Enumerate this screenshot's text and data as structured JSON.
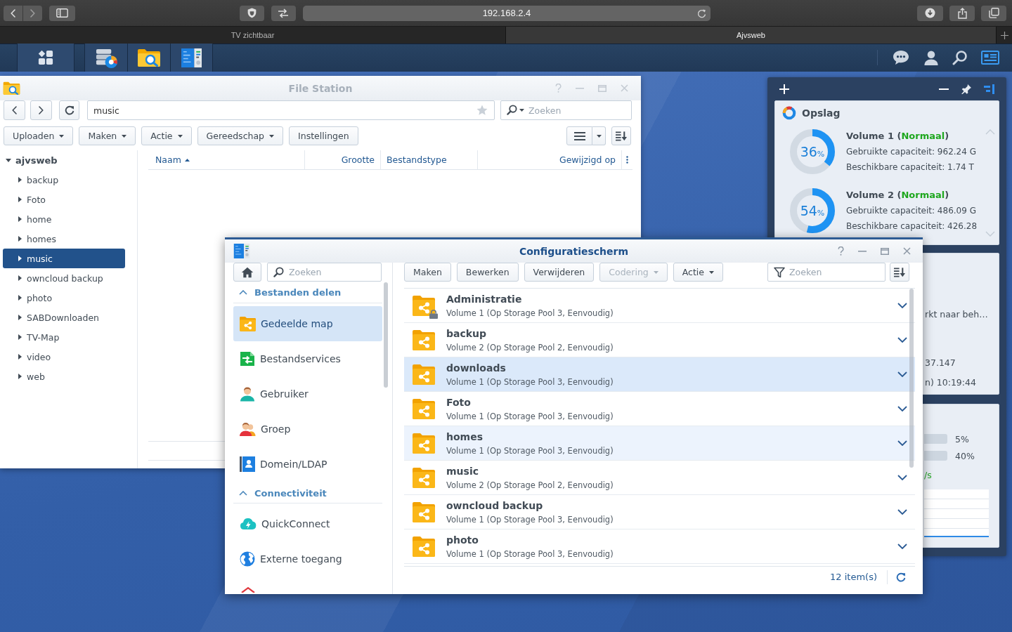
{
  "browser": {
    "address": "192.168.2.4",
    "tabs": [
      {
        "label": "TV zichtbaar",
        "selected": false
      },
      {
        "label": "Ajvsweb",
        "selected": true
      }
    ]
  },
  "file_station": {
    "title": "File Station",
    "active": false,
    "path": "music",
    "search": {
      "placeholder": "Zoeken"
    },
    "toolbar": [
      {
        "label": "Uploaden",
        "dropdown": true
      },
      {
        "label": "Maken",
        "dropdown": true
      },
      {
        "label": "Actie",
        "dropdown": true
      },
      {
        "label": "Gereedschap",
        "dropdown": true
      },
      {
        "label": "Instellingen",
        "dropdown": false
      }
    ],
    "tree": [
      {
        "label": "ajvsweb",
        "expanded": true,
        "selected": false,
        "children": [
          {
            "label": "backup",
            "expanded": false,
            "selected": false
          },
          {
            "label": "Foto",
            "expanded": false,
            "selected": false
          },
          {
            "label": "home",
            "expanded": false,
            "selected": false
          },
          {
            "label": "homes",
            "expanded": false,
            "selected": false
          },
          {
            "label": "music",
            "expanded": false,
            "selected": true
          },
          {
            "label": "owncloud backup",
            "expanded": false,
            "selected": false
          },
          {
            "label": "photo",
            "expanded": false,
            "selected": false
          },
          {
            "label": "SABDownloaden",
            "expanded": false,
            "selected": false
          },
          {
            "label": "TV-Map",
            "expanded": false,
            "selected": false
          },
          {
            "label": "video",
            "expanded": false,
            "selected": false
          },
          {
            "label": "web",
            "expanded": false,
            "selected": false
          }
        ]
      }
    ],
    "columns": [
      {
        "label": "Naam",
        "sorted": true
      },
      {
        "label": "Grootte",
        "sorted": false
      },
      {
        "label": "Bestandstype",
        "sorted": false
      },
      {
        "label": "Gewijzigd op",
        "sorted": false
      }
    ]
  },
  "control_panel": {
    "title": "Configuratiescherm",
    "active": true,
    "search": {
      "placeholder": "Zoeken"
    },
    "sections": [
      {
        "label": "Bestanden delen",
        "expanded": true,
        "items": [
          {
            "label": "Gedeelde map",
            "selected": true
          },
          {
            "label": "Bestandservices",
            "selected": false
          },
          {
            "label": "Gebruiker",
            "selected": false
          },
          {
            "label": "Groep",
            "selected": false
          },
          {
            "label": "Domein/LDAP",
            "selected": false
          }
        ]
      },
      {
        "label": "Connectiviteit",
        "expanded": true,
        "items": [
          {
            "label": "QuickConnect",
            "selected": false
          },
          {
            "label": "Externe toegang",
            "selected": false
          }
        ]
      }
    ],
    "toolbar": [
      {
        "label": "Maken",
        "dropdown": false,
        "disabled": false
      },
      {
        "label": "Bewerken",
        "dropdown": false,
        "disabled": false
      },
      {
        "label": "Verwijderen",
        "dropdown": false,
        "disabled": false
      },
      {
        "label": "Codering",
        "dropdown": true,
        "disabled": true
      },
      {
        "label": "Actie",
        "dropdown": true,
        "disabled": false
      }
    ],
    "filter": {
      "placeholder": "Zoeken"
    },
    "folders": [
      {
        "name": "Administratie",
        "location": "Volume 1 (Op Storage Pool 3, Eenvoudig)",
        "locked": true,
        "selected": false,
        "hovered": false
      },
      {
        "name": "backup",
        "location": "Volume 2 (Op Storage Pool 2, Eenvoudig)",
        "locked": false,
        "selected": false,
        "hovered": false
      },
      {
        "name": "downloads",
        "location": "Volume 1 (Op Storage Pool 3, Eenvoudig)",
        "locked": false,
        "selected": true,
        "hovered": false
      },
      {
        "name": "Foto",
        "location": "Volume 1 (Op Storage Pool 3, Eenvoudig)",
        "locked": false,
        "selected": false,
        "hovered": false
      },
      {
        "name": "homes",
        "location": "Volume 1 (Op Storage Pool 3, Eenvoudig)",
        "locked": false,
        "selected": false,
        "hovered": true
      },
      {
        "name": "music",
        "location": "Volume 2 (Op Storage Pool 2, Eenvoudig)",
        "locked": false,
        "selected": false,
        "hovered": false
      },
      {
        "name": "owncloud backup",
        "location": "Volume 1 (Op Storage Pool 3, Eenvoudig)",
        "locked": false,
        "selected": false,
        "hovered": false
      },
      {
        "name": "photo",
        "location": "Volume 1 (Op Storage Pool 3, Eenvoudig)",
        "locked": false,
        "selected": false,
        "hovered": false
      }
    ],
    "footer": {
      "count": "12 item(s)"
    }
  },
  "widgets": {
    "storage": {
      "title": "Opslag",
      "volumes": [
        {
          "label": "Volume 1 (",
          "status": "Normaal",
          "label_end": ")",
          "healthy": true,
          "percent": "36",
          "unit": "%",
          "level": 0.36,
          "used": "Gebruikte capaciteit: 962.24 G",
          "free": "Beschikbare capaciteit: 1.74 T"
        },
        {
          "label": "Volume 2 (",
          "status": "Normaal",
          "label_end": ")",
          "healthy": true,
          "percent": "54",
          "unit": "%",
          "level": 0.54,
          "used": "Gebruikte capaciteit: 486.09 G",
          "free": "Beschikbare capaciteit: 426.28"
        }
      ]
    },
    "partial_widget_1": {
      "texts": [
        "rkt naar beh…",
        "37.147",
        "n) 10:19:44"
      ]
    },
    "partial_widget_2": {
      "bars": [
        {
          "reading": "5%"
        },
        {
          "reading": "40%"
        }
      ],
      "rate": "/s"
    }
  }
}
